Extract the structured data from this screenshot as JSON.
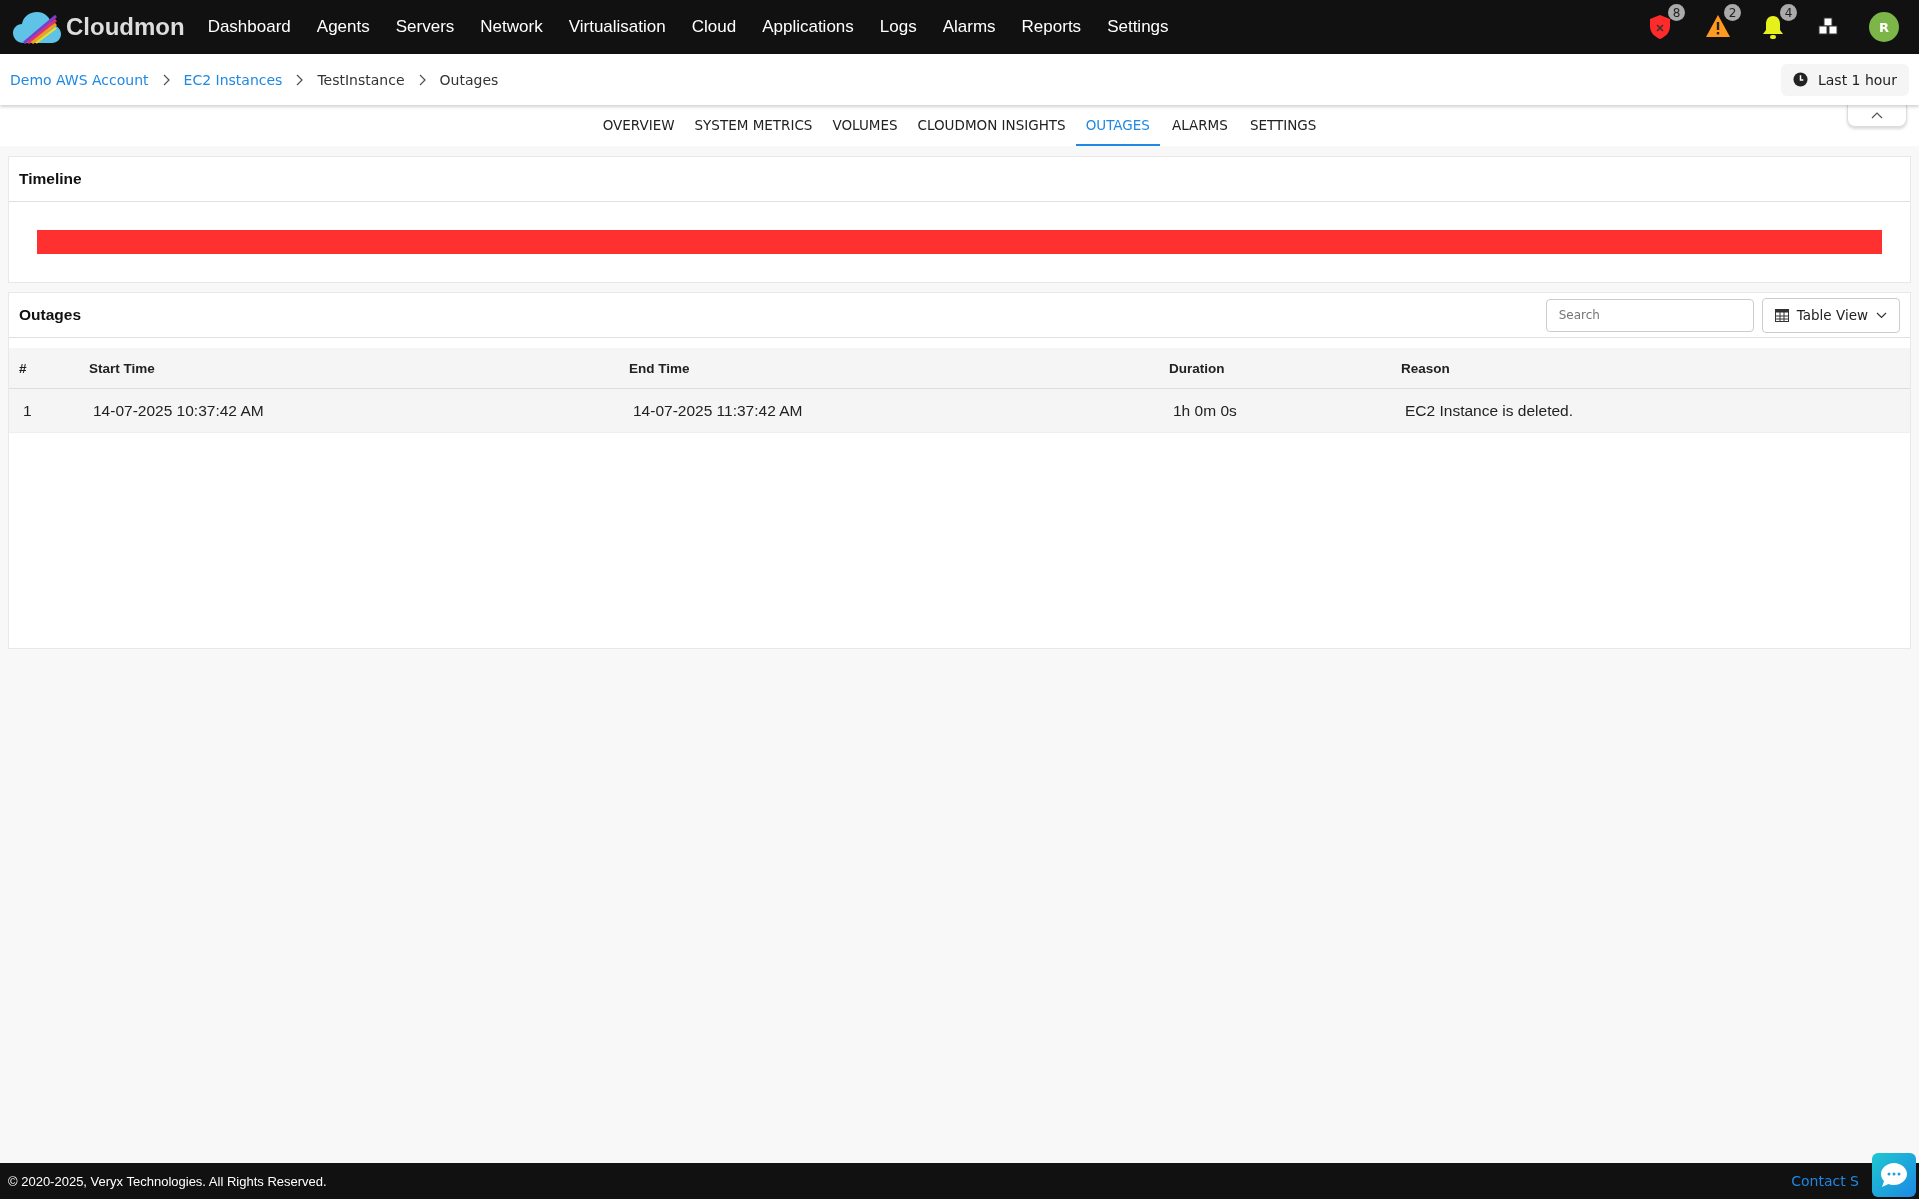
{
  "brand": "Cloudmon",
  "nav": [
    {
      "label": "Dashboard"
    },
    {
      "label": "Agents"
    },
    {
      "label": "Servers"
    },
    {
      "label": "Network"
    },
    {
      "label": "Virtualisation"
    },
    {
      "label": "Cloud"
    },
    {
      "label": "Applications"
    },
    {
      "label": "Logs"
    },
    {
      "label": "Alarms"
    },
    {
      "label": "Reports"
    },
    {
      "label": "Settings"
    }
  ],
  "alerts": [
    {
      "kind": "shield",
      "count": "8"
    },
    {
      "kind": "warning",
      "count": "2"
    },
    {
      "kind": "bell",
      "count": "4"
    }
  ],
  "avatar": "R",
  "breadcrumbs": [
    {
      "label": "Demo AWS Account",
      "link": true
    },
    {
      "label": "EC2 Instances",
      "link": true
    },
    {
      "label": "TestInstance",
      "link": false
    },
    {
      "label": "Outages",
      "link": false
    }
  ],
  "time_range": "Last 1 hour",
  "tabs": [
    {
      "label": "OVERVIEW",
      "selected": false
    },
    {
      "label": "SYSTEM METRICS",
      "selected": false
    },
    {
      "label": "VOLUMES",
      "selected": false
    },
    {
      "label": "CLOUDMON INSIGHTS",
      "selected": false
    },
    {
      "label": "OUTAGES",
      "selected": true
    },
    {
      "label": "ALARMS",
      "selected": false
    },
    {
      "label": "SETTINGS",
      "selected": false
    }
  ],
  "timeline": {
    "title": "Timeline",
    "segments": [
      {
        "color": "#ff3030"
      }
    ]
  },
  "outages": {
    "title": "Outages",
    "search": {
      "placeholder": "Search"
    },
    "view": "Table View",
    "columns": [
      "#",
      "Start Time",
      "End Time",
      "Duration",
      "Reason"
    ],
    "rows": [
      [
        "1",
        "14-07-2025 10:37:42 AM",
        "14-07-2025 11:37:42 AM",
        "1h 0m 0s",
        "EC2 Instance is deleted."
      ]
    ]
  },
  "footer": {
    "copyright": "© 2020-2025, Veryx Technologies. All Rights Reserved.",
    "link": "Contact S"
  }
}
